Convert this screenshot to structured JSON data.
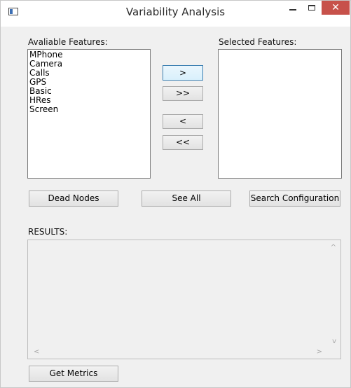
{
  "window": {
    "title": "Variability Analysis",
    "close_glyph": "✕"
  },
  "available": {
    "label": "Avaliable Features:",
    "items": [
      "MPhone",
      "Camera",
      "Calls",
      "GPS",
      "Basic",
      "HRes",
      "Screen"
    ]
  },
  "selected": {
    "label": "Selected Features:",
    "items": []
  },
  "transfer_buttons": {
    "add": ">",
    "add_all": ">>",
    "remove": "<",
    "remove_all": "<<"
  },
  "actions": {
    "dead_nodes": "Dead Nodes",
    "see_all": "See All",
    "search_configuration": "Search Configuration",
    "get_metrics": "Get Metrics"
  },
  "results": {
    "label": "RESULTS:",
    "text": ""
  },
  "scroll_glyphs": {
    "up": "^",
    "down": "v",
    "left": "<",
    "right": ">"
  }
}
